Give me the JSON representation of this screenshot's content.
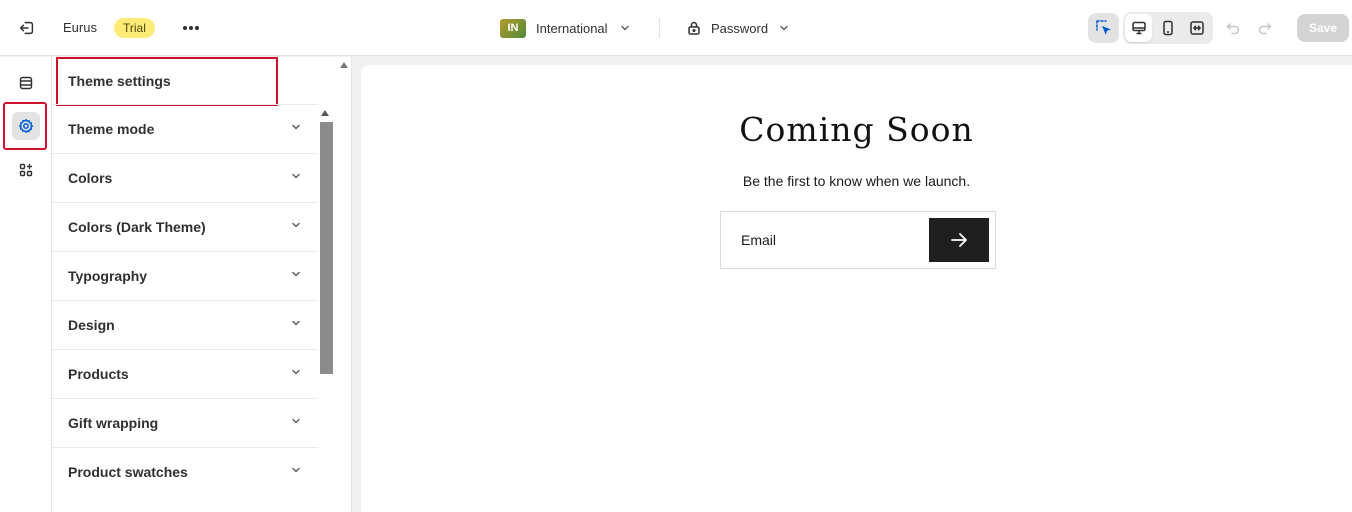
{
  "topbar": {
    "exit_icon": "exit-icon",
    "store_name": "Eurus",
    "trial_badge": "Trial",
    "more_icon": "more-horizontal-icon",
    "market": {
      "flag_code": "IN",
      "label": "International"
    },
    "password": {
      "label": "Password",
      "icon": "lock-icon"
    },
    "inspector_icon": "inspector-select-icon",
    "devices": [
      "desktop-icon",
      "mobile-icon",
      "fullscreen-icon"
    ],
    "undo_icon": "undo-icon",
    "redo_icon": "redo-icon",
    "save_label": "Save"
  },
  "rail": {
    "items": [
      {
        "name": "sections",
        "icon": "sections-icon"
      },
      {
        "name": "theme-settings",
        "icon": "gear-icon",
        "active": true
      },
      {
        "name": "apps",
        "icon": "apps-icon"
      }
    ]
  },
  "panel": {
    "title": "Theme settings",
    "items": [
      {
        "label": "Theme mode"
      },
      {
        "label": "Colors"
      },
      {
        "label": "Colors (Dark Theme)"
      },
      {
        "label": "Typography"
      },
      {
        "label": "Design"
      },
      {
        "label": "Products"
      },
      {
        "label": "Gift wrapping"
      },
      {
        "label": "Product swatches"
      }
    ]
  },
  "preview": {
    "title": "Coming Soon",
    "subtitle": "Be the first to know when we launch.",
    "email_placeholder": "Email",
    "submit_icon": "arrow-right-icon"
  },
  "colors": {
    "highlight": "#d0112b",
    "accent_active": "#005bd3",
    "trial_badge_bg": "#ffeb78",
    "submit_bg": "#1f1f1f"
  }
}
